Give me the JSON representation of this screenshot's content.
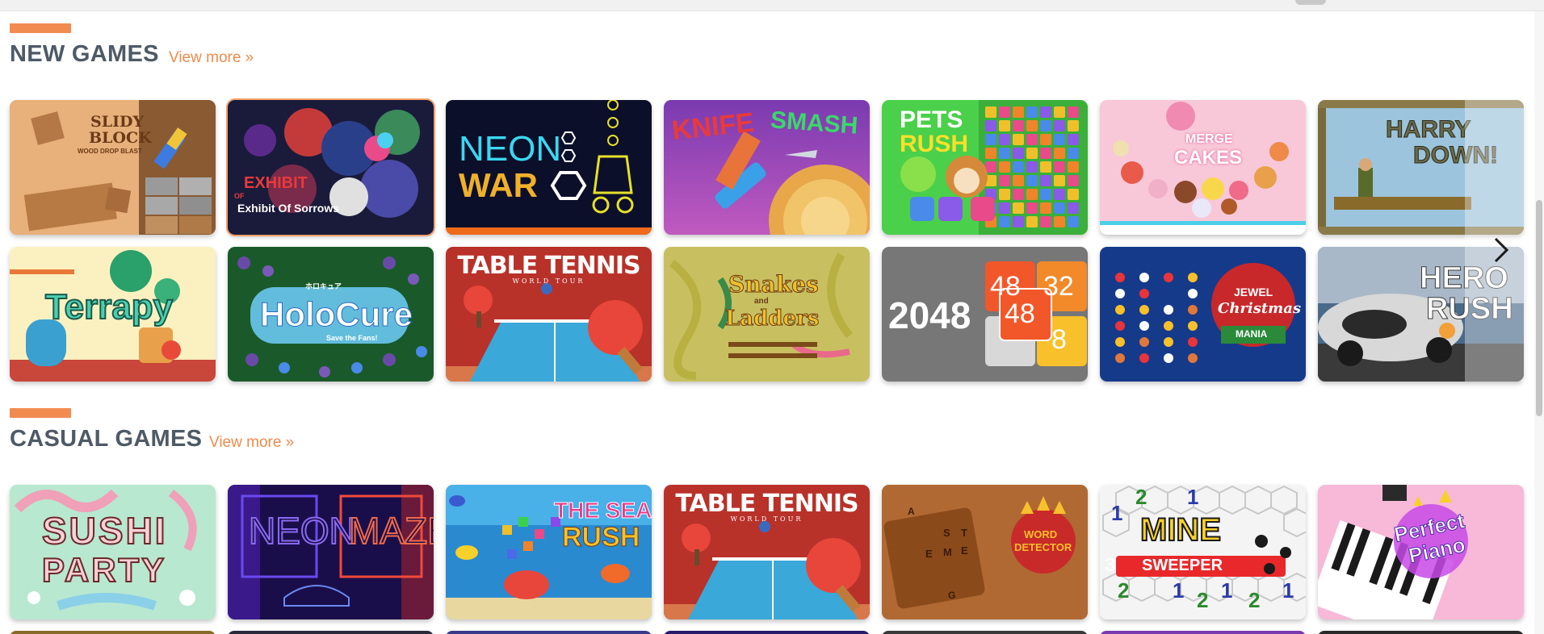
{
  "sections": [
    {
      "title": "NEW GAMES",
      "more": "View more »"
    },
    {
      "title": "CASUAL GAMES",
      "more": "View more »"
    }
  ],
  "new_games": [
    {
      "t1": "SLIDY",
      "t2": "BLOCK",
      "t3": "WOOD DROP BLAST"
    },
    {
      "t1": "EXHIBIT",
      "t2": "OF",
      "t3": "Exhibit Of Sorrows"
    },
    {
      "t1": "NEON",
      "t2": "WAR"
    },
    {
      "t1": "KNIFE",
      "t2": "SMASH"
    },
    {
      "t1": "PETS",
      "t2": "RUSH"
    },
    {
      "t1": "MERGE",
      "t2": "CAKES"
    },
    {
      "t1": "HARRY",
      "t2": "DOWN!"
    },
    {
      "t1": "Terrapy"
    },
    {
      "t1": "HoloCure",
      "t2": "ホロキュア",
      "t3": "Save the Fans!"
    },
    {
      "t1": "TABLE TENNIS",
      "t2": "WORLD TOUR"
    },
    {
      "t1": "Snakes",
      "t2": "and",
      "t3": "Ladders"
    },
    {
      "t1": "2048",
      "t2": "48",
      "t3": "32",
      "t4": "48",
      "t5": "8"
    },
    {
      "t1": "JEWEL",
      "t2": "Christmas",
      "t3": "MANIA"
    },
    {
      "t1": "HERO",
      "t2": "RUSH"
    }
  ],
  "casual_games": [
    {
      "t1": "SUSHI",
      "t2": "PARTY"
    },
    {
      "t1": "NEON",
      "t2": "MAZE"
    },
    {
      "t1": "THE SEA",
      "t2": "RUSH"
    },
    {
      "t1": "TABLE TENNIS",
      "t2": "WORLD TOUR"
    },
    {
      "t1": "WORD",
      "t2": "DETECTOR",
      "t3": "A",
      "t4": "S",
      "t5": "T",
      "t6": "E",
      "t7": "M",
      "t8": "E",
      "t9": "G"
    },
    {
      "t1": "MINE",
      "t2": "SWEEPER",
      "t3": "3",
      "t4": "2",
      "t5": "1"
    },
    {
      "t1": "Perfect",
      "t2": "Piano"
    }
  ],
  "colors": {
    "accent": "#f28b50",
    "title": "#4e5a66",
    "link": "#f08a4b"
  },
  "icons": {
    "next": "chevron-right-icon"
  }
}
